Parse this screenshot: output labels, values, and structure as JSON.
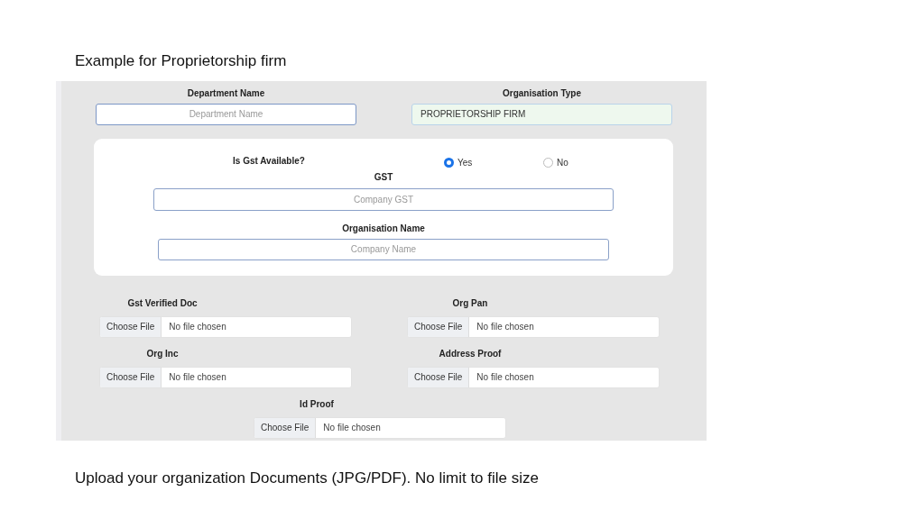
{
  "heading": "Example for Proprietorship firm",
  "form": {
    "top_fields": [
      {
        "label": "Department Name",
        "placeholder": "Department Name"
      },
      {
        "label": "Organisation Type",
        "value": "PROPRIETORSHIP FIRM"
      }
    ],
    "gst_question": {
      "label": "Is Gst Available?",
      "options": [
        {
          "label": "Yes",
          "selected": true
        },
        {
          "label": "No",
          "selected": false
        }
      ]
    },
    "gst_field": {
      "label": "GST",
      "placeholder": "Company GST"
    },
    "org_name_field": {
      "label": "Organisation Name",
      "placeholder": "Company Name"
    },
    "documents": [
      {
        "label": "Gst Verified Doc",
        "button": "Choose File",
        "status": "No file chosen"
      },
      {
        "label": "Org Pan",
        "button": "Choose File",
        "status": "No file chosen"
      },
      {
        "label": "Org Inc",
        "button": "Choose File",
        "status": "No file chosen"
      },
      {
        "label": "Address Proof",
        "button": "Choose File",
        "status": "No file chosen"
      },
      {
        "label": "Id Proof",
        "button": "Choose File",
        "status": "No file chosen"
      }
    ]
  },
  "caption": "Upload your organization Documents (JPG/PDF). No limit to file size"
}
